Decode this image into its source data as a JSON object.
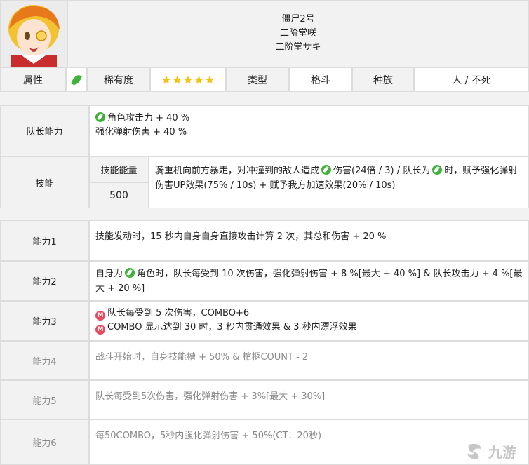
{
  "names": {
    "line1": "僵尸2号",
    "line2": "二阶堂咲",
    "line3": "二阶堂サキ"
  },
  "attr_row": {
    "attribute_label": "属性",
    "rarity_label": "稀有度",
    "rarity_stars": 5,
    "type_label": "类型",
    "type_value": "格斗",
    "race_label": "种族",
    "race_value": "人 / 不死"
  },
  "leader": {
    "label": "队长能力",
    "line1": "角色攻击力 + 40 %",
    "line2": "强化弹射伤害 + 40 %"
  },
  "skill": {
    "label": "技能",
    "energy_label": "技能能量",
    "energy_value": "500",
    "desc_part1": "骑重机向前方暴走，对冲撞到的敌人造成",
    "desc_part2": "伤害(24倍 / 3) / 队长为",
    "desc_part3": "时，赋予强化弹射伤害UP效果(75% / 10s) + 赋予我方加速效果(20% / 10s)"
  },
  "abilities": [
    {
      "label": "能力1",
      "text": "技能发动时，15 秒内自身自身直接攻击计算 2 次，其总和伤害 + 20 %"
    },
    {
      "label": "能力2",
      "text_a": "自身为",
      "text_b": "角色时，队长每受到 10 次伤害，强化弹射伤害 + 8 %[最大 + 40 %] & 队长攻击力 + 4 %[最大 + 20 %]"
    },
    {
      "label": "能力3",
      "line1": "队长每受到 5 次伤害，COMBO+6",
      "line2": "COMBO 显示达到 30 时，3 秒内贯通效果 & 3 秒内漂浮效果"
    },
    {
      "label": "能力4",
      "text": "战斗开始时，自身技能槽 + 50% & 棺柩COUNT - 2"
    },
    {
      "label": "能力5",
      "text": "队长每受到5次伤害，强化弹射伤害 + 3%[最大 + 30%]"
    },
    {
      "label": "能力6",
      "text": "每50COMBO，5秒内强化弹射伤害 + 50%(CT：20秒)"
    }
  ],
  "icons": {
    "m_badge": "M"
  },
  "watermark": "九游",
  "colors": {
    "header_bg": "#f2f2f2",
    "leaf_green": "#3fb23a",
    "m_red": "#e84a5f",
    "star_yellow": "#f6c400"
  }
}
